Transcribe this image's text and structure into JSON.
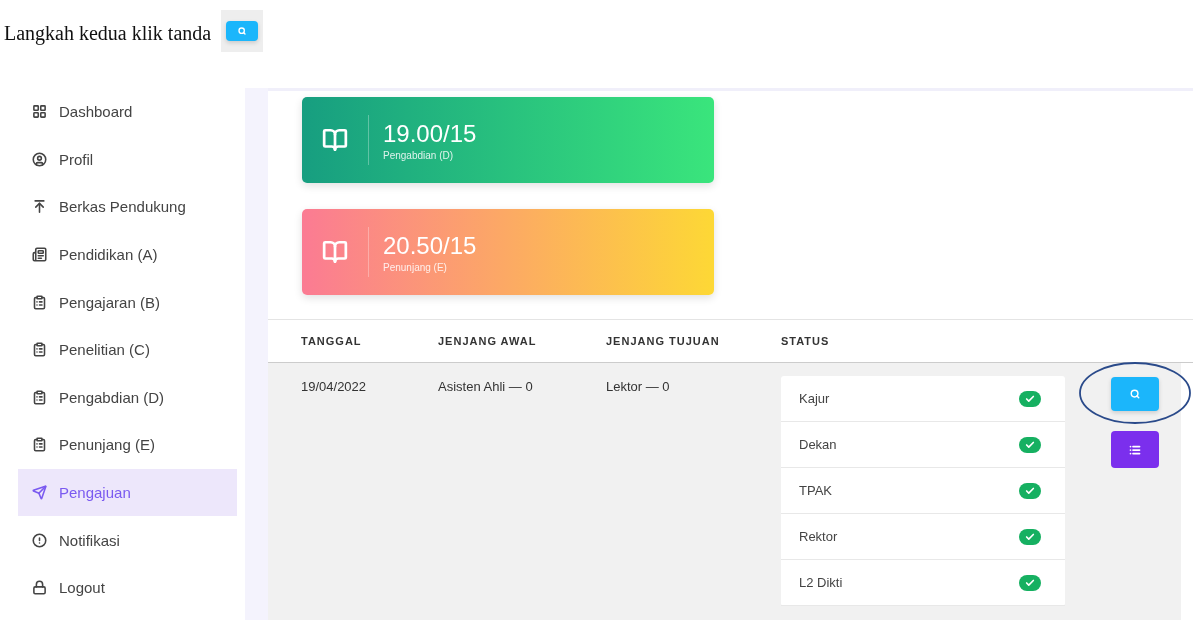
{
  "caption": "Langkah kedua klik tanda",
  "sidebar": {
    "items": [
      {
        "label": "Dashboard",
        "selected": false
      },
      {
        "label": "Profil",
        "selected": false
      },
      {
        "label": "Berkas Pendukung",
        "selected": false
      },
      {
        "label": "Pendidikan (A)",
        "selected": false
      },
      {
        "label": "Pengajaran (B)",
        "selected": false
      },
      {
        "label": "Penelitian (C)",
        "selected": false
      },
      {
        "label": "Pengabdian (D)",
        "selected": false
      },
      {
        "label": "Penunjang (E)",
        "selected": false
      },
      {
        "label": "Pengajuan",
        "selected": true
      },
      {
        "label": "Notifikasi",
        "selected": false
      },
      {
        "label": "Logout",
        "selected": false
      }
    ]
  },
  "cards": [
    {
      "value": "19.00/15",
      "label": "Pengabdian (D)",
      "kind": "green"
    },
    {
      "value": "20.50/15",
      "label": "Penunjang (E)",
      "kind": "orange"
    }
  ],
  "table": {
    "columns": [
      "TANGGAL",
      "JENJANG AWAL",
      "JENJANG TUJUAN",
      "STATUS"
    ],
    "rows": [
      {
        "tanggal": "19/04/2022",
        "jenjang_awal": "Asisten Ahli — 0",
        "jenjang_tujuan": "Lektor — 0",
        "status": [
          {
            "label": "Kajur",
            "approved": true
          },
          {
            "label": "Dekan",
            "approved": true
          },
          {
            "label": "TPAK",
            "approved": true
          },
          {
            "label": "Rektor",
            "approved": true
          },
          {
            "label": "L2 Dikti",
            "approved": true
          }
        ]
      }
    ]
  }
}
